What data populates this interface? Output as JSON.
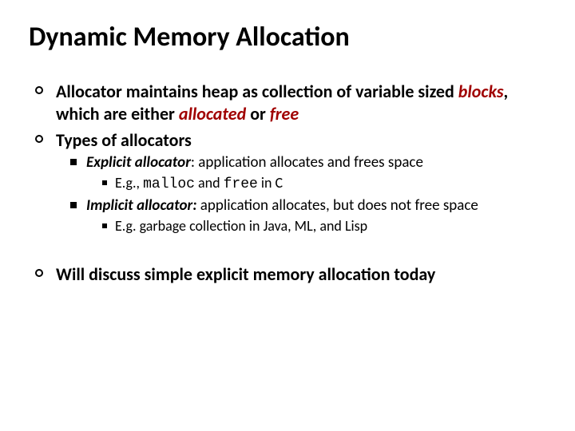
{
  "title": "Dynamic Memory Allocation",
  "b1": {
    "p1": "Allocator maintains heap as collection of variable sized ",
    "blocks": "blocks",
    "p2": ", which are either ",
    "allocated": "allocated",
    "p3": " or ",
    "free": "free"
  },
  "b2": "Types of allocators",
  "sub1": {
    "lead": "Explicit allocator",
    "rest": ":  application allocates and frees space",
    "eg_pre": "E.g., ",
    "malloc": "malloc",
    "eg_mid": " and ",
    "free": "free",
    "eg_post": " in C"
  },
  "sub2": {
    "lead": "Implicit allocator:",
    "rest": " application allocates, but does not free space",
    "eg": "E.g. garbage collection in Java, ML, and Lisp"
  },
  "b3": "Will discuss simple explicit memory allocation today"
}
